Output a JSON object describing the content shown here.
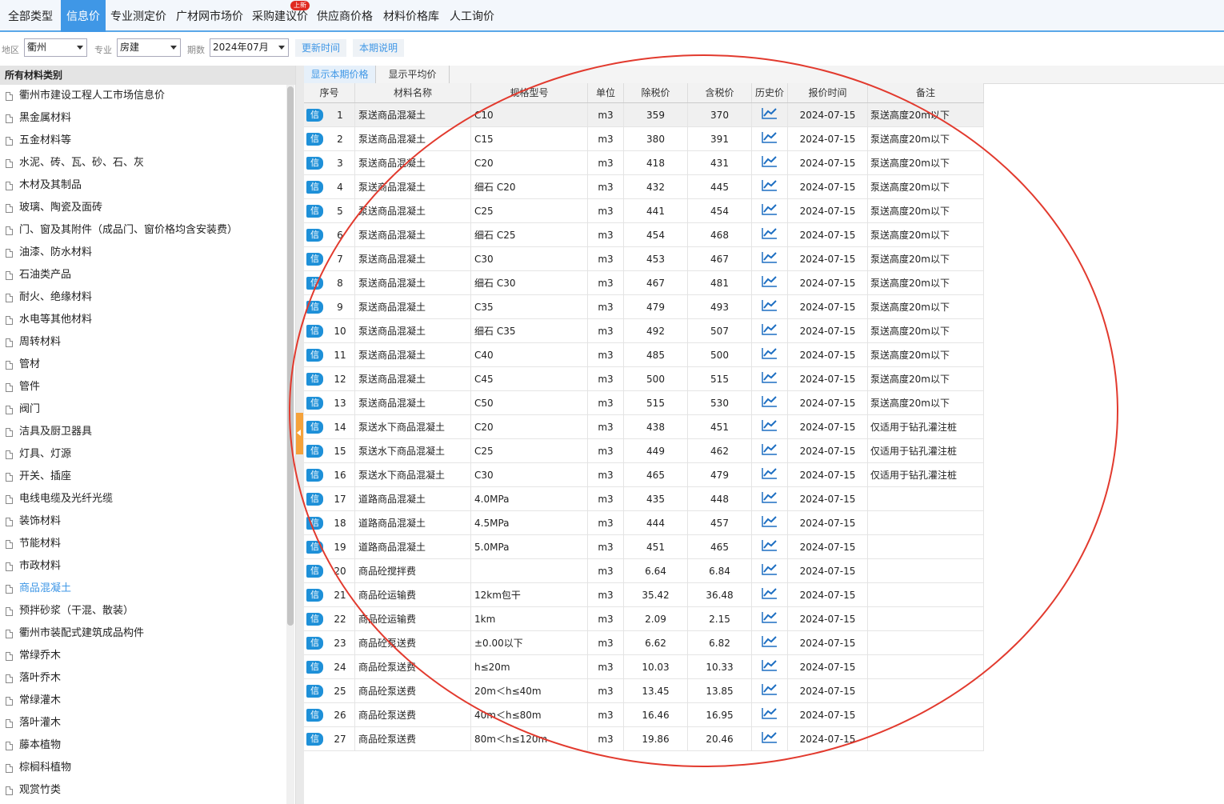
{
  "top_tabs": [
    {
      "label": "全部类型",
      "active": false
    },
    {
      "label": "信息价",
      "active": true
    },
    {
      "label": "专业测定价",
      "active": false
    },
    {
      "label": "广材网市场价",
      "active": false
    },
    {
      "label": "采购建议价",
      "active": false,
      "badge": "上新"
    },
    {
      "label": "供应商价格",
      "active": false
    },
    {
      "label": "材料价格库",
      "active": false
    },
    {
      "label": "人工询价",
      "active": false
    }
  ],
  "filters": {
    "region_label": "地区",
    "region_value": "衢州",
    "major_label": "专业",
    "major_value": "房建",
    "period_label": "期数",
    "period_value": "2024年07月",
    "update_time_button": "更新时间",
    "period_note_button": "本期说明"
  },
  "sidebar": {
    "header": "所有材料类别",
    "items": [
      "衢州市建设工程人工市场信息价",
      "黑金属材料",
      "五金材料等",
      "水泥、砖、瓦、砂、石、灰",
      "木材及其制品",
      "玻璃、陶瓷及面砖",
      "门、窗及其附件（成品门、窗价格均含安装费）",
      "油漆、防水材料",
      "石油类产品",
      "耐火、绝缘材料",
      "水电等其他材料",
      "周转材料",
      "管材",
      "管件",
      "阀门",
      "洁具及厨卫器具",
      "灯具、灯源",
      "开关、插座",
      "电线电缆及光纤光缆",
      "装饰材料",
      "节能材料",
      "市政材料",
      "商品混凝土",
      "预拌砂浆（干混、散装）",
      "衢州市装配式建筑成品构件",
      "常绿乔木",
      "落叶乔木",
      "常绿灌木",
      "落叶灌木",
      "藤本植物",
      "棕榈科植物",
      "观赏竹类"
    ],
    "active_item": "商品混凝土"
  },
  "subtabs": [
    {
      "label": "显示本期价格",
      "active": true
    },
    {
      "label": "显示平均价",
      "active": false
    }
  ],
  "table": {
    "columns": [
      "序号",
      "材料名称",
      "规格型号",
      "单位",
      "除税价",
      "含税价",
      "历史价",
      "报价时间",
      "备注"
    ],
    "badge_label": "信",
    "rows": [
      [
        "1",
        "泵送商品混凝土",
        "C10",
        "m3",
        "359",
        "370",
        "2024-07-15",
        "泵送高度20m以下"
      ],
      [
        "2",
        "泵送商品混凝土",
        "C15",
        "m3",
        "380",
        "391",
        "2024-07-15",
        "泵送高度20m以下"
      ],
      [
        "3",
        "泵送商品混凝土",
        "C20",
        "m3",
        "418",
        "431",
        "2024-07-15",
        "泵送高度20m以下"
      ],
      [
        "4",
        "泵送商品混凝土",
        "细石 C20",
        "m3",
        "432",
        "445",
        "2024-07-15",
        "泵送高度20m以下"
      ],
      [
        "5",
        "泵送商品混凝土",
        "C25",
        "m3",
        "441",
        "454",
        "2024-07-15",
        "泵送高度20m以下"
      ],
      [
        "6",
        "泵送商品混凝土",
        "细石 C25",
        "m3",
        "454",
        "468",
        "2024-07-15",
        "泵送高度20m以下"
      ],
      [
        "7",
        "泵送商品混凝土",
        "C30",
        "m3",
        "453",
        "467",
        "2024-07-15",
        "泵送高度20m以下"
      ],
      [
        "8",
        "泵送商品混凝土",
        "细石 C30",
        "m3",
        "467",
        "481",
        "2024-07-15",
        "泵送高度20m以下"
      ],
      [
        "9",
        "泵送商品混凝土",
        "C35",
        "m3",
        "479",
        "493",
        "2024-07-15",
        "泵送高度20m以下"
      ],
      [
        "10",
        "泵送商品混凝土",
        "细石 C35",
        "m3",
        "492",
        "507",
        "2024-07-15",
        "泵送高度20m以下"
      ],
      [
        "11",
        "泵送商品混凝土",
        "C40",
        "m3",
        "485",
        "500",
        "2024-07-15",
        "泵送高度20m以下"
      ],
      [
        "12",
        "泵送商品混凝土",
        "C45",
        "m3",
        "500",
        "515",
        "2024-07-15",
        "泵送高度20m以下"
      ],
      [
        "13",
        "泵送商品混凝土",
        "C50",
        "m3",
        "515",
        "530",
        "2024-07-15",
        "泵送高度20m以下"
      ],
      [
        "14",
        "泵送水下商品混凝土",
        "C20",
        "m3",
        "438",
        "451",
        "2024-07-15",
        "仅适用于钻孔灌注桩"
      ],
      [
        "15",
        "泵送水下商品混凝土",
        "C25",
        "m3",
        "449",
        "462",
        "2024-07-15",
        "仅适用于钻孔灌注桩"
      ],
      [
        "16",
        "泵送水下商品混凝土",
        "C30",
        "m3",
        "465",
        "479",
        "2024-07-15",
        "仅适用于钻孔灌注桩"
      ],
      [
        "17",
        "道路商品混凝土",
        "4.0MPa",
        "m3",
        "435",
        "448",
        "2024-07-15",
        ""
      ],
      [
        "18",
        "道路商品混凝土",
        "4.5MPa",
        "m3",
        "444",
        "457",
        "2024-07-15",
        ""
      ],
      [
        "19",
        "道路商品混凝土",
        "5.0MPa",
        "m3",
        "451",
        "465",
        "2024-07-15",
        ""
      ],
      [
        "20",
        "商品砼搅拌费",
        "",
        "m3",
        "6.64",
        "6.84",
        "2024-07-15",
        ""
      ],
      [
        "21",
        "商品砼运输费",
        "12km包干",
        "m3",
        "35.42",
        "36.48",
        "2024-07-15",
        ""
      ],
      [
        "22",
        "商品砼运输费",
        "1km",
        "m3",
        "2.09",
        "2.15",
        "2024-07-15",
        ""
      ],
      [
        "23",
        "商品砼泵送费",
        "±0.00以下",
        "m3",
        "6.62",
        "6.82",
        "2024-07-15",
        ""
      ],
      [
        "24",
        "商品砼泵送费",
        "h≤20m",
        "m3",
        "10.03",
        "10.33",
        "2024-07-15",
        ""
      ],
      [
        "25",
        "商品砼泵送费",
        "20m＜h≤40m",
        "m3",
        "13.45",
        "13.85",
        "2024-07-15",
        ""
      ],
      [
        "26",
        "商品砼泵送费",
        "40m＜h≤80m",
        "m3",
        "16.46",
        "16.95",
        "2024-07-15",
        ""
      ],
      [
        "27",
        "商品砼泵送费",
        "80m＜h≤120m",
        "m3",
        "19.86",
        "20.46",
        "2024-07-15",
        ""
      ]
    ],
    "selected_row": "1"
  },
  "colors": {
    "accent": "#3f97e6",
    "badge": "#1e90d8",
    "annotation": "#e23a2e",
    "handle": "#f5a23a"
  },
  "icons": {
    "history": "line-chart-icon",
    "sidebar_item": "document-icon",
    "dropdown": "caret-down-icon"
  }
}
